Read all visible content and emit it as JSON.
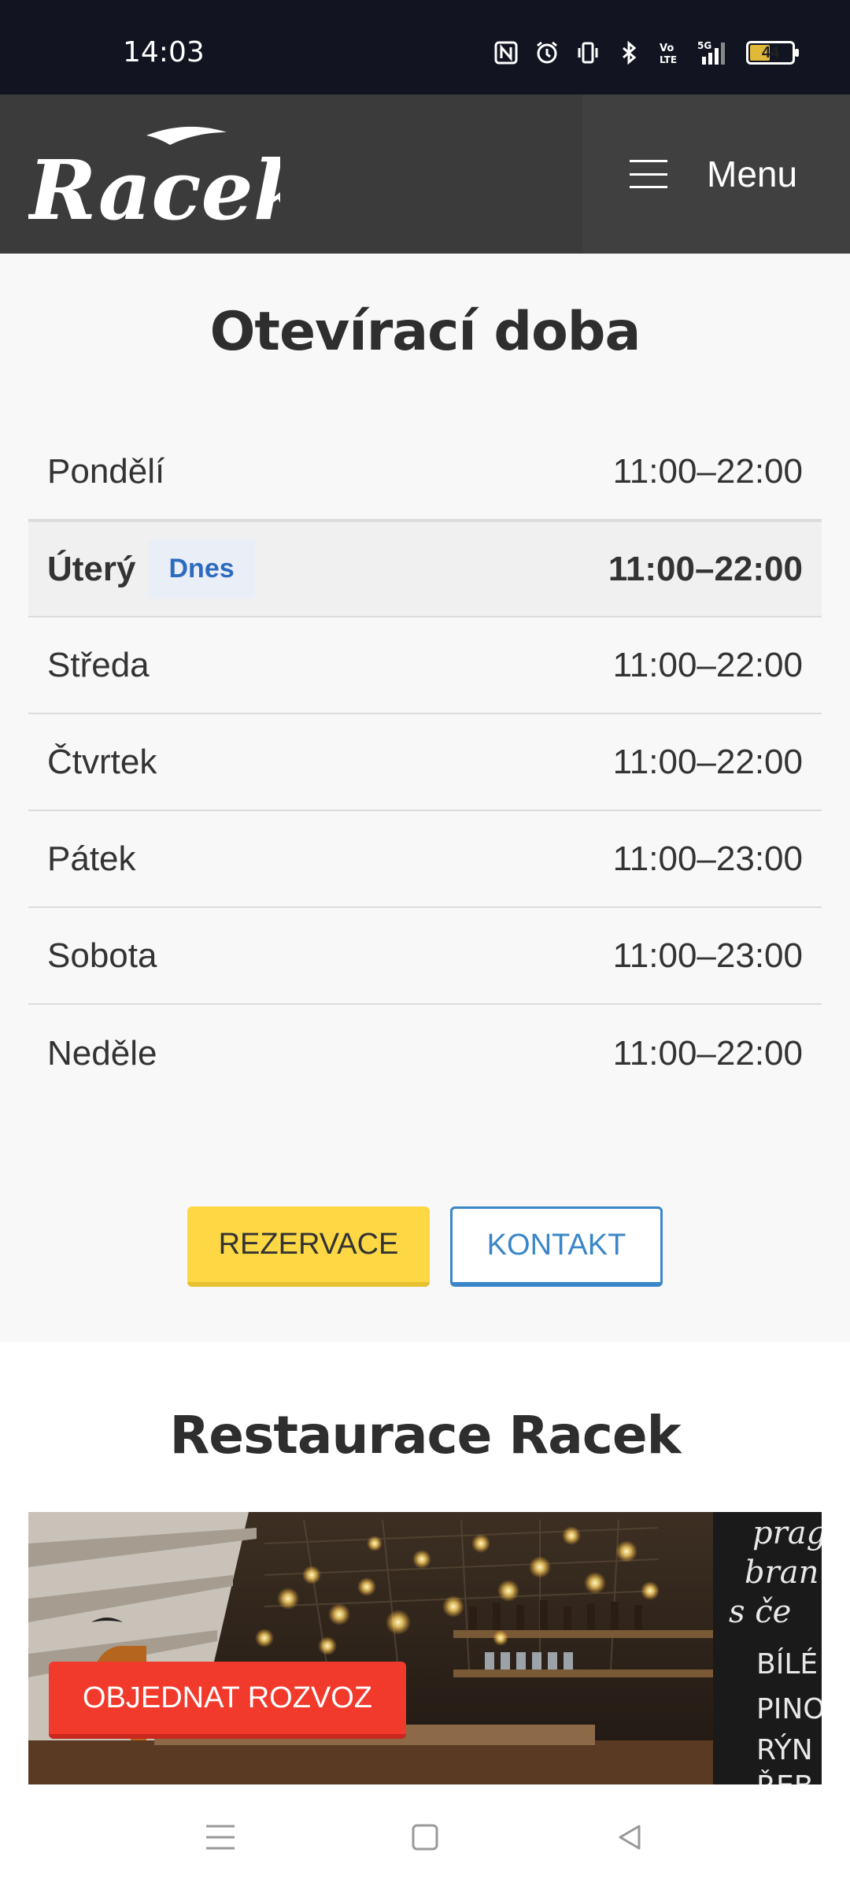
{
  "status_bar": {
    "time": "14:03",
    "battery": "44",
    "icons": [
      "nfc-icon",
      "alarm-icon",
      "vibrate-icon",
      "bluetooth-icon",
      "volte-icon",
      "5g-signal-icon",
      "battery-icon"
    ]
  },
  "header": {
    "logo_text": "Racek",
    "menu_label": "Menu"
  },
  "hours": {
    "title": "Otevírací doba",
    "rows": [
      {
        "day": "Pondělí",
        "time": "11:00–22:00"
      },
      {
        "day": "Úterý",
        "time": "11:00–22:00",
        "badge": "Dnes"
      },
      {
        "day": "Středa",
        "time": "11:00–22:00"
      },
      {
        "day": "Čtvrtek",
        "time": "11:00–22:00"
      },
      {
        "day": "Pátek",
        "time": "11:00–23:00"
      },
      {
        "day": "Sobota",
        "time": "11:00–23:00"
      },
      {
        "day": "Neděle",
        "time": "11:00–22:00"
      }
    ],
    "reservation_label": "REZERVACE",
    "contact_label": "KONTAKT"
  },
  "restaurant": {
    "title": "Restaurace Racek",
    "order_label": "OBJEDNAT ROZVOZ",
    "chalkboard_lines": [
      "prag",
      "bran",
      "s če",
      "BÍLÉ",
      "PINO",
      "RÝN",
      "ŘEB"
    ]
  },
  "colors": {
    "header_bg": "#3b3b3b",
    "accent_yellow": "#fdd844",
    "accent_blue": "#3a86c8",
    "accent_red": "#f23a2c",
    "today_badge": "#2d6bbf"
  }
}
